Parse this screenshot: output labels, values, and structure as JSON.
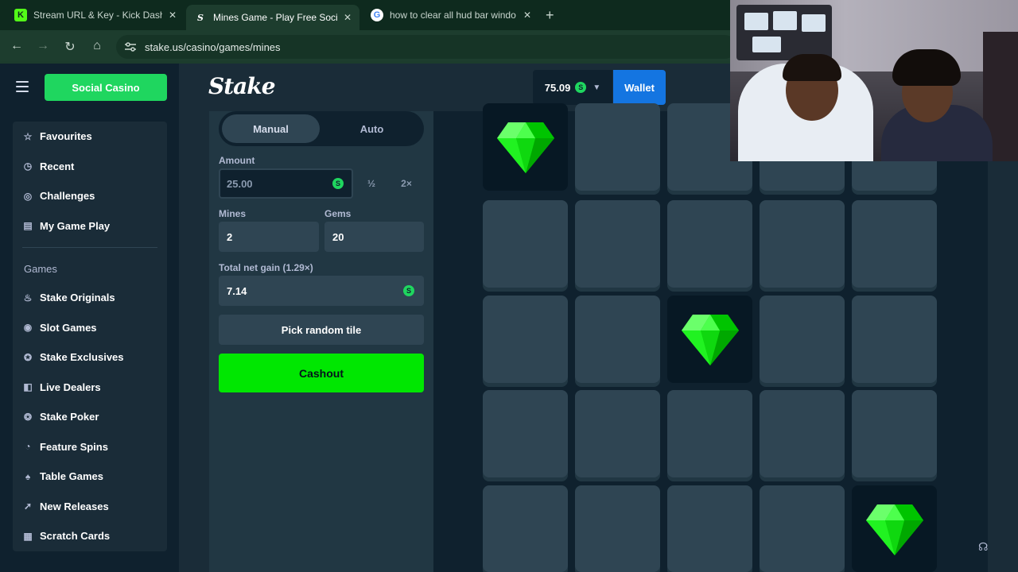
{
  "browser": {
    "tabs": [
      {
        "label": "Stream URL & Key - Kick Dashb",
        "favicon": "K",
        "favicon_color": "#53fc18"
      },
      {
        "label": "Mines Game - Play Free Social",
        "favicon": "S",
        "favicon_color": "#1d3d2e"
      },
      {
        "label": "how to clear all hud bar windo",
        "favicon": "G",
        "favicon_color": "#ffffff"
      }
    ],
    "close_glyph": "✕",
    "new_tab_glyph": "+",
    "url": "stake.us/casino/games/mines"
  },
  "header": {
    "social_casino_label": "Social Casino",
    "logo_text": "Stake",
    "balance": "75.09",
    "currency_glyph": "S",
    "wallet_label": "Wallet"
  },
  "sidebar": {
    "top_items": [
      {
        "label": "Favourites",
        "icon": "star-icon"
      },
      {
        "label": "Recent",
        "icon": "clock-icon"
      },
      {
        "label": "Challenges",
        "icon": "challenge-icon"
      },
      {
        "label": "My Game Play",
        "icon": "receipt-icon"
      }
    ],
    "games_heading": "Games",
    "game_items": [
      {
        "label": "Stake Originals",
        "icon": "flame-icon"
      },
      {
        "label": "Slot Games",
        "icon": "slot-icon"
      },
      {
        "label": "Stake Exclusives",
        "icon": "badge-icon"
      },
      {
        "label": "Live Dealers",
        "icon": "dealer-icon"
      },
      {
        "label": "Stake Poker",
        "icon": "poker-chip-icon"
      },
      {
        "label": "Feature Spins",
        "icon": "spin-icon"
      },
      {
        "label": "Table Games",
        "icon": "cards-icon"
      },
      {
        "label": "New Releases",
        "icon": "rocket-icon"
      },
      {
        "label": "Scratch Cards",
        "icon": "scratch-icon"
      }
    ]
  },
  "controls": {
    "mode_manual": "Manual",
    "mode_auto": "Auto",
    "amount_label": "Amount",
    "amount_value": "25.00",
    "half_label": "½",
    "double_label": "2×",
    "mines_label": "Mines",
    "mines_value": "2",
    "gems_label": "Gems",
    "gems_value": "20",
    "net_gain_label": "Total net gain (1.29×)",
    "net_gain_value": "7.14",
    "pick_random_label": "Pick random tile",
    "cashout_label": "Cashout"
  },
  "board": {
    "gem_color": "#00e701",
    "revealed_gems": [
      [
        0,
        0
      ],
      [
        2,
        2
      ],
      [
        4,
        4
      ]
    ]
  },
  "icons": {
    "support": "headset-icon"
  }
}
